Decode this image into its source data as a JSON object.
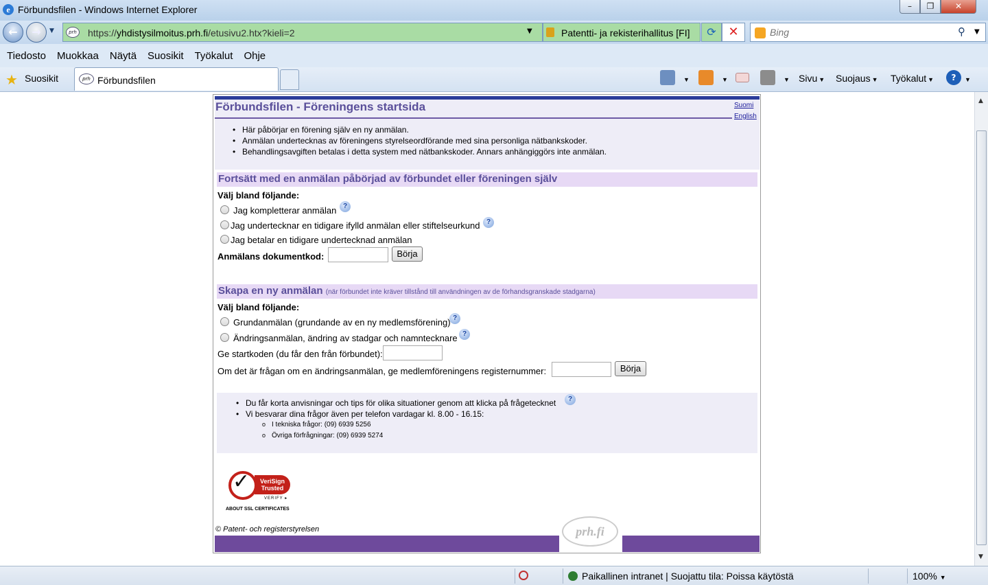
{
  "window": {
    "title": "Förbundsfilen - Windows Internet Explorer",
    "min": "–",
    "max": "❐",
    "close": "✕"
  },
  "address": {
    "url_prefix": "https://",
    "url_domain": "yhdistysilmoitus.prh.fi",
    "url_path": "/etusivu2.htx?kieli=2",
    "cert_label": "Patentti- ja rekisterihallitus [FI]",
    "search_placeholder": "Bing"
  },
  "menu": [
    "Tiedosto",
    "Muokkaa",
    "Näytä",
    "Suosikit",
    "Työkalut",
    "Ohje"
  ],
  "favbar": {
    "favorites_label": "Suosikit",
    "tab_label": "Förbundsfilen",
    "tab_icon_text": "prh",
    "page_menu": "Sivu",
    "security_menu": "Suojaus",
    "tools_menu": "Työkalut"
  },
  "page": {
    "title": "Förbundsfilen - Föreningens startsida",
    "lang_fi": "Suomi",
    "lang_en": "English",
    "intro": [
      "Här påbörjar en förening själv en ny anmälan.",
      "Anmälan undertecknas av föreningens styrelseordförande med sina personliga nätbankskoder.",
      "Behandlingsavgiften betalas i detta system med nätbankskoder. Annars anhängiggörs inte anmälan."
    ],
    "section1": {
      "title": "Fortsätt med en anmälan påbörjad av förbundet eller föreningen själv",
      "choose": "Välj bland följande:",
      "options": [
        "Jag kompletterar anmälan",
        "Jag undertecknar en tidigare ifylld anmälan eller stiftelseurkund",
        "Jag betalar en tidigare undertecknad anmälan"
      ],
      "code_label": "Anmälans dokumentkod:",
      "start_button": "Börja"
    },
    "section2": {
      "title": "Skapa en ny anmälan",
      "subtitle": "(när förbundet inte kräver tillstånd till användningen av de förhandsgranskade stadgarna)",
      "choose": "Välj bland följande:",
      "options": [
        "Grundanmälan (grundande av en ny medlemsförening)",
        "Ändringsanmälan, ändring av stadgar och namntecknare"
      ],
      "startcode_label": "Ge startkoden (du får den från förbundet):",
      "regnum_label": "Om det är frågan om en ändringsanmälan, ge medlemföreningens registernummer:",
      "start_button": "Börja"
    },
    "info": {
      "tip": "Du får korta anvisningar och tips för olika situationer genom att klicka på frågetecknet",
      "phone": "Vi besvarar dina frågor även per telefon vardagar kl. 8.00 - 16.15:",
      "tech": "I tekniska frågor: (09) 6939 5256",
      "other": "Övriga förfrågningar: (09) 6939 5274"
    },
    "seal": {
      "line1": "VeriSign",
      "line2": "Trusted",
      "verify": "VERIFY ▸",
      "about": "ABOUT SSL CERTIFICATES"
    },
    "copyright": "© Patent- och registerstyrelsen",
    "footer_logo": "prh.fi"
  },
  "status": {
    "zone": "Paikallinen intranet | Suojattu tila: Poissa käytöstä",
    "zoom": "100%"
  }
}
